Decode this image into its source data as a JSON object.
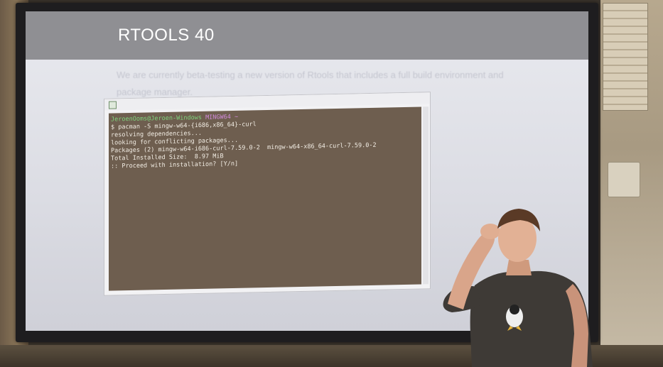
{
  "slide": {
    "title": "RTOOLS 40",
    "body_text": "We are currently beta-testing a new version of Rtools that includes a full build environment and package manager.",
    "terminal": {
      "prompt_user": "JeroenOoms@Jeroen-Windows",
      "prompt_shell": "MINGW64 ~",
      "lines": [
        "$ pacman -S mingw-w64-{i686,x86_64}-curl",
        "resolving dependencies...",
        "looking for conflicting packages...",
        "",
        "Packages (2) mingw-w64-i686-curl-7.59.0-2  mingw-w64-x86_64-curl-7.59.0-2",
        "",
        "Total Installed Size:  8.97 MiB",
        "",
        ":: Proceed with installation? [Y/n]"
      ]
    }
  },
  "colors": {
    "terminal_bg": "#6e5e4f",
    "slide_header": "#8f8f93",
    "screen": "#e3e4ea",
    "shirt": "#3e3a36"
  }
}
